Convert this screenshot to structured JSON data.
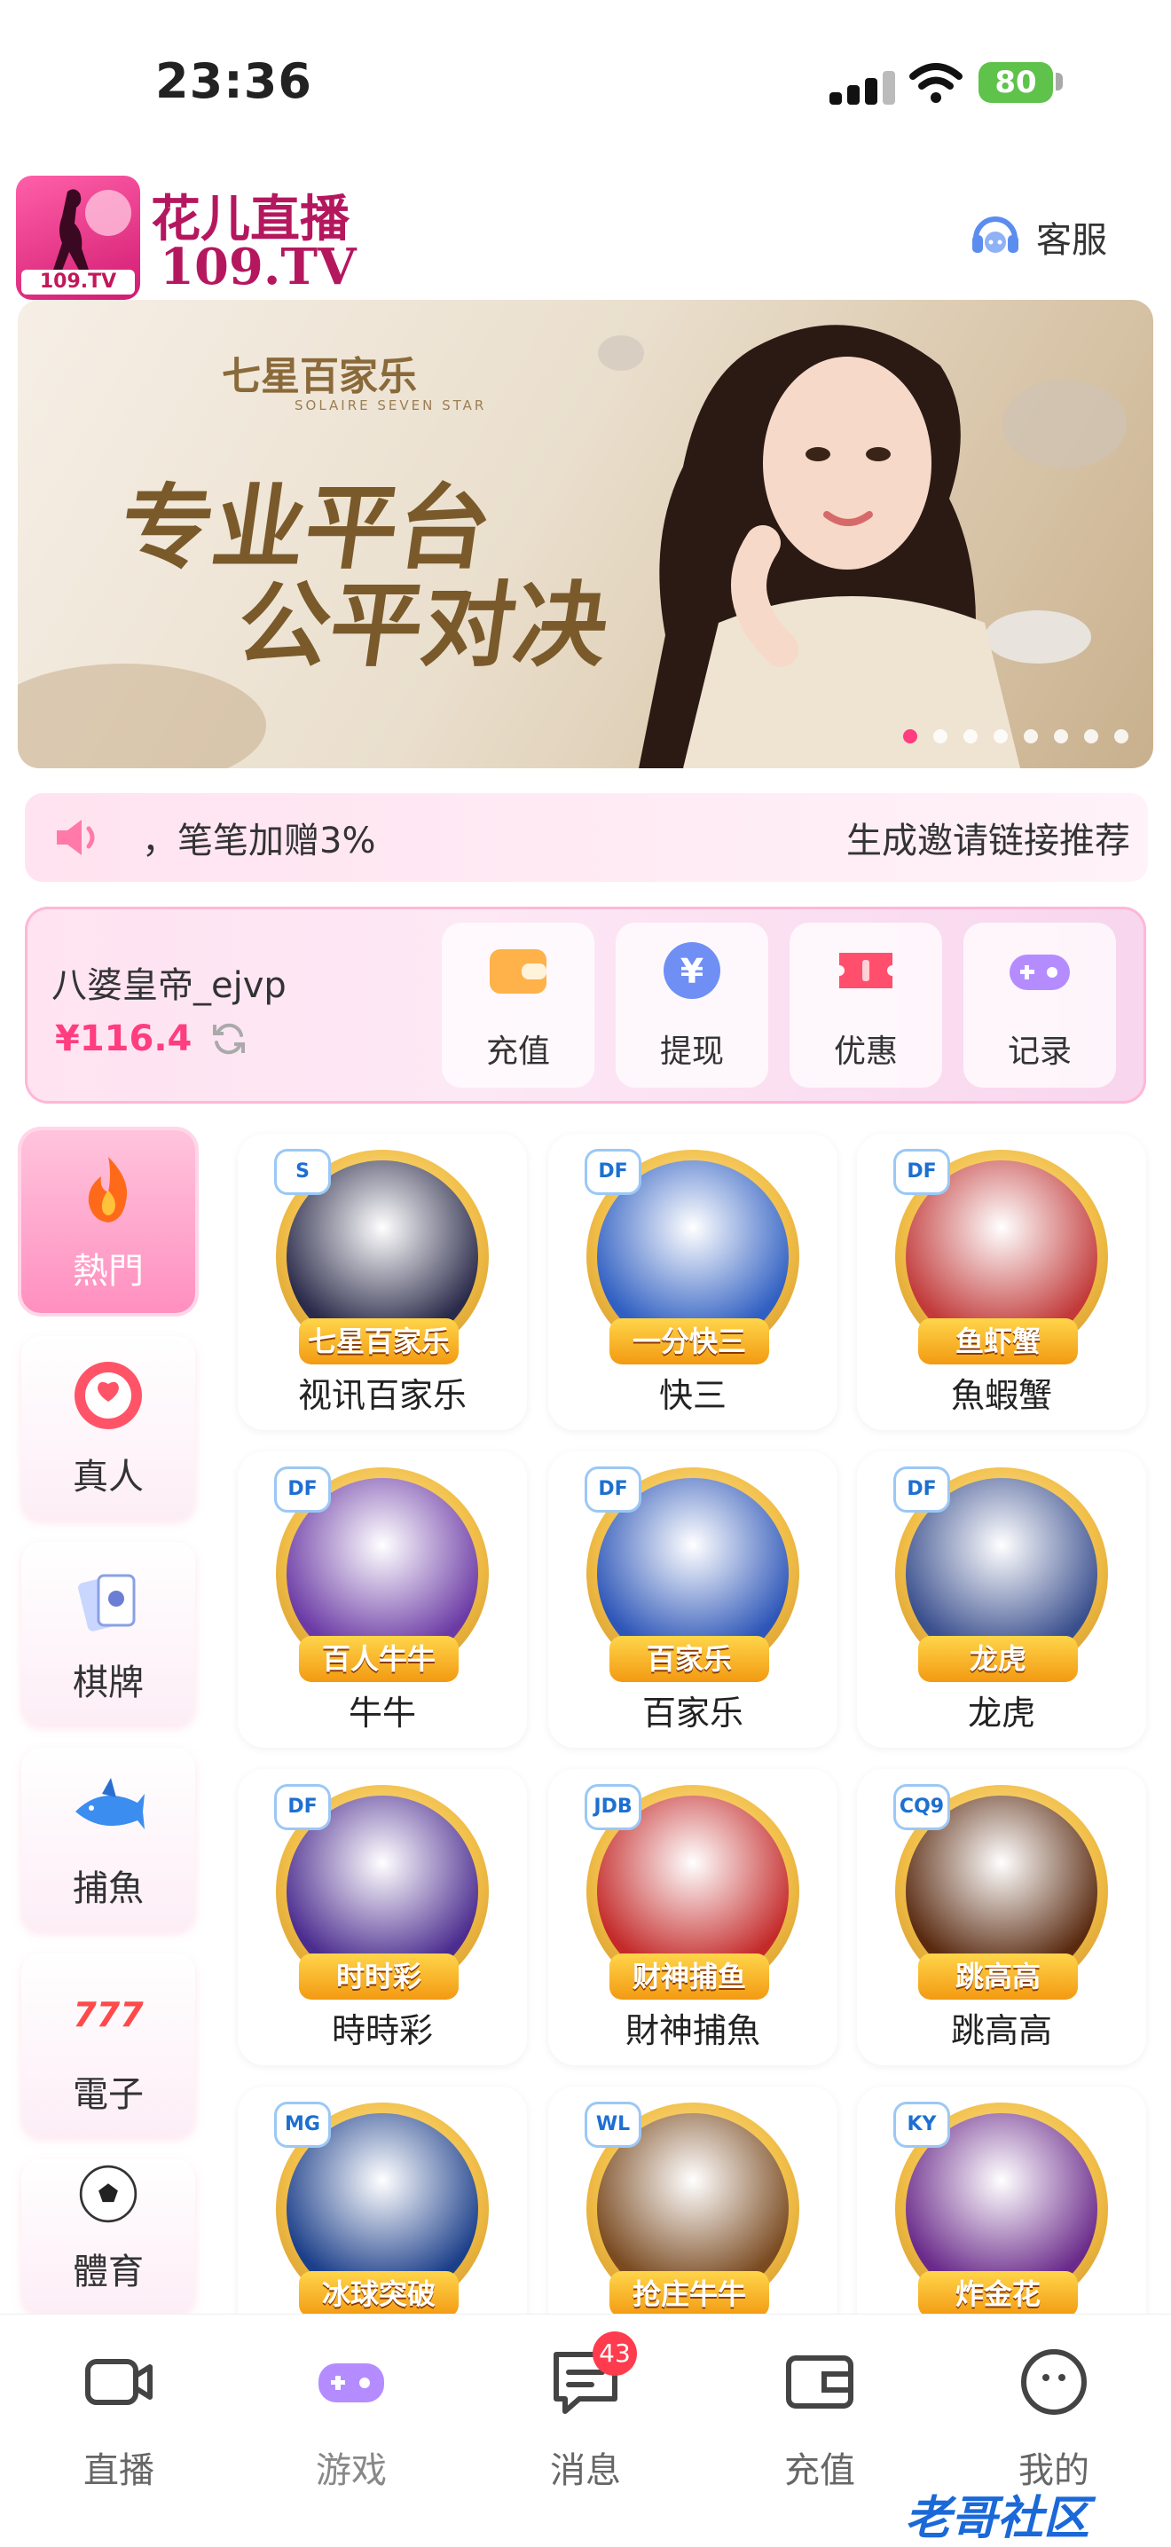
{
  "status_bar": {
    "time": "23:36",
    "battery": "80"
  },
  "header": {
    "logo_tv": "109.TV",
    "brand_line1": "花儿直播",
    "brand_line2": "109.TV",
    "service_label": "客服"
  },
  "banner": {
    "logo_text": "七星百家乐",
    "logo_sub": "SOLAIRE SEVEN STAR",
    "title_line1": "专业平台",
    "title_line2": "公平对决",
    "active_dot": 0,
    "dot_count": 8
  },
  "marquee": {
    "text1": "，笔笔加赠3%",
    "text2": "生成邀请链接推荐"
  },
  "wallet": {
    "username": "八婆皇帝_ejvp",
    "balance": "¥116.4",
    "actions": [
      {
        "label": "充值",
        "icon": "wallet-icon"
      },
      {
        "label": "提现",
        "icon": "yuan-icon"
      },
      {
        "label": "优惠",
        "icon": "ticket-icon"
      },
      {
        "label": "记录",
        "icon": "gamepad-icon"
      }
    ]
  },
  "categories": [
    {
      "label": "熱門",
      "icon": "flame-icon",
      "active": true
    },
    {
      "label": "真人",
      "icon": "chip-icon",
      "active": false
    },
    {
      "label": "棋牌",
      "icon": "cards-icon",
      "active": false
    },
    {
      "label": "捕魚",
      "icon": "shark-icon",
      "active": false
    },
    {
      "label": "電子",
      "icon": "slot-777-icon",
      "active": false
    },
    {
      "label": "體育",
      "icon": "soccer-ball-icon",
      "active": false
    }
  ],
  "games": [
    {
      "name": "视讯百家乐",
      "ribbon": "七星百家乐",
      "badge": "S"
    },
    {
      "name": "快三",
      "ribbon": "一分快三",
      "badge": "DF"
    },
    {
      "name": "魚蝦蟹",
      "ribbon": "鱼虾蟹",
      "badge": "DF"
    },
    {
      "name": "牛牛",
      "ribbon": "百人牛牛",
      "badge": "DF"
    },
    {
      "name": "百家乐",
      "ribbon": "百家乐",
      "badge": "DF"
    },
    {
      "name": "龙虎",
      "ribbon": "龙虎",
      "badge": "DF"
    },
    {
      "name": "時時彩",
      "ribbon": "时时彩",
      "badge": "DF"
    },
    {
      "name": "財神捕魚",
      "ribbon": "财神捕鱼",
      "badge": "JDB"
    },
    {
      "name": "跳高高",
      "ribbon": "跳高高",
      "badge": "CQ9"
    },
    {
      "name": "",
      "ribbon": "冰球突破",
      "badge": "MG"
    },
    {
      "name": "",
      "ribbon": "抢庄牛牛",
      "badge": "WL"
    },
    {
      "name": "",
      "ribbon": "炸金花",
      "badge": "KY"
    }
  ],
  "bottom_nav": [
    {
      "label": "直播",
      "icon": "camera-icon"
    },
    {
      "label": "游戏",
      "icon": "gamepad-icon"
    },
    {
      "label": "消息",
      "icon": "message-icon",
      "badge": "43"
    },
    {
      "label": "充值",
      "icon": "wallet-icon"
    },
    {
      "label": "我的",
      "icon": "profile-icon"
    }
  ],
  "watermark": "老哥社区",
  "colors": {
    "accent": "#ff3d7f",
    "brand": "#b5175f",
    "battery": "#5fc24a",
    "badge": "#ff3b4e"
  }
}
